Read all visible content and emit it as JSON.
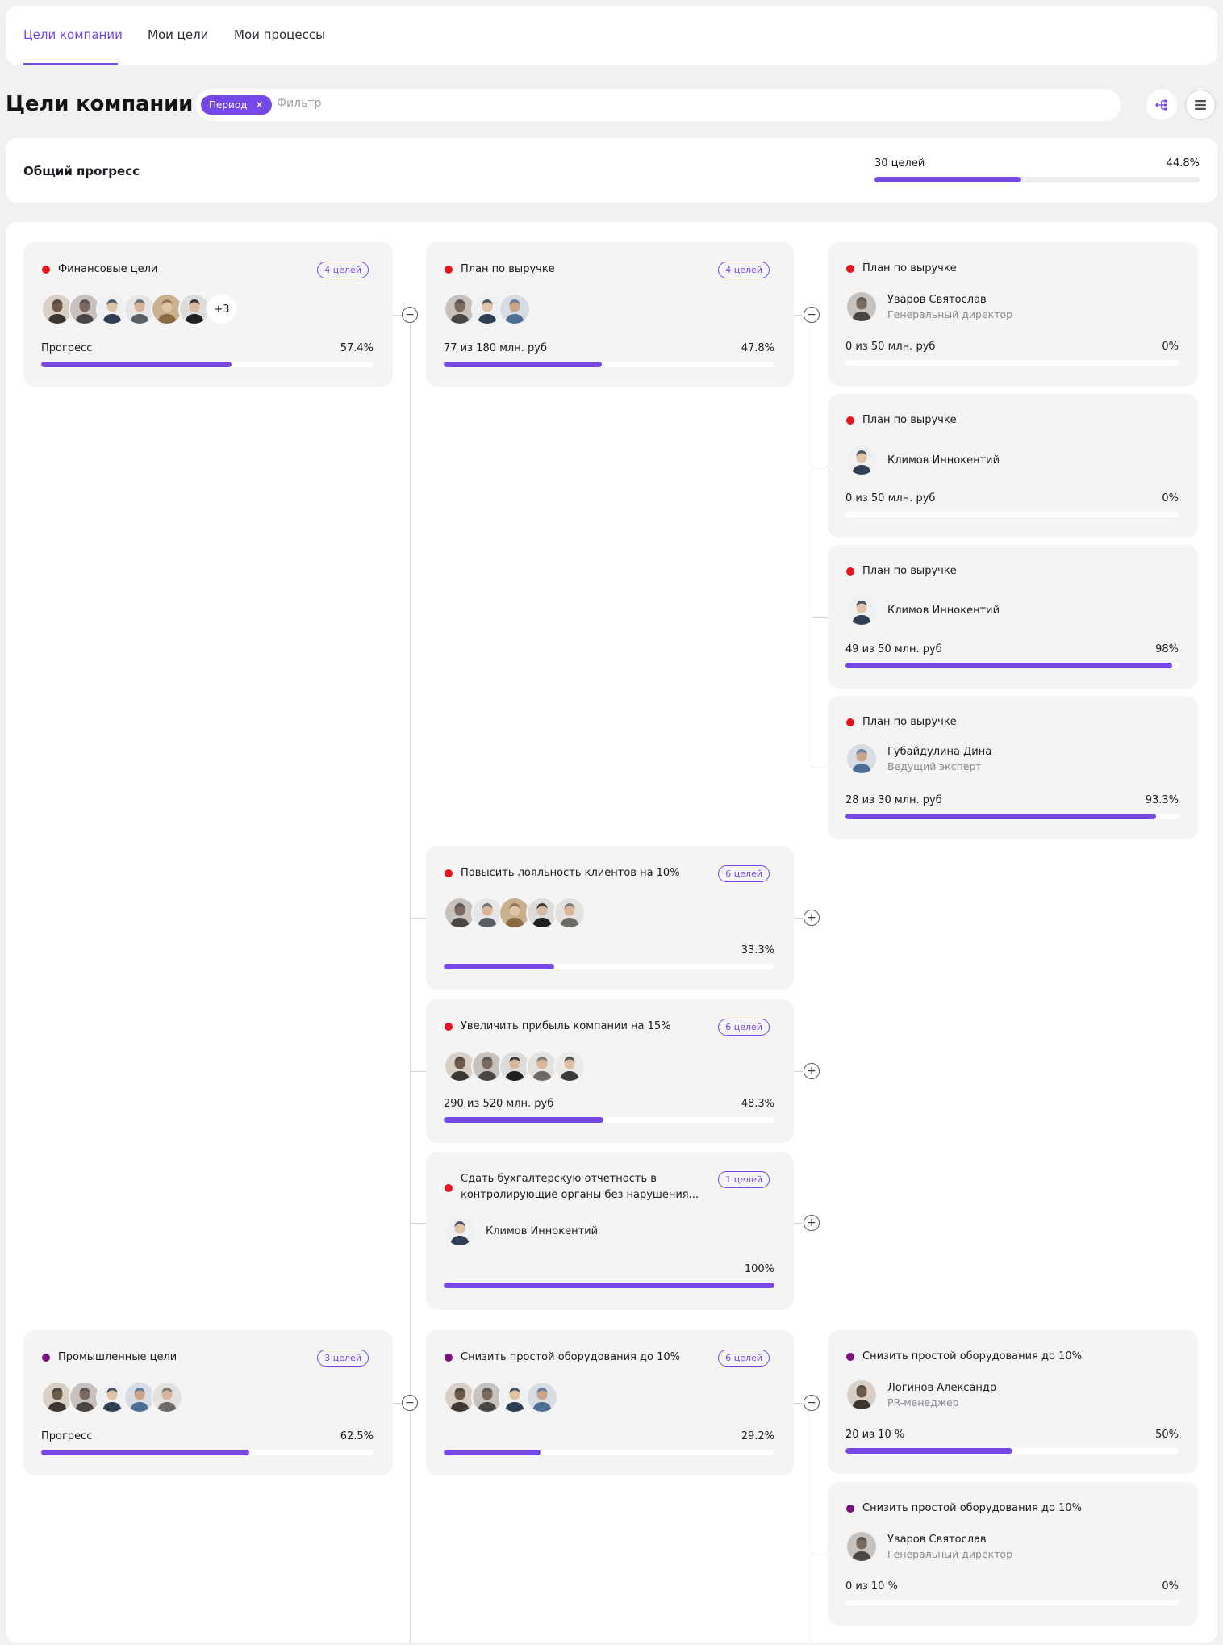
{
  "tabs": [
    {
      "label": "Цели компании"
    },
    {
      "label": "Мои цели"
    },
    {
      "label": "Мои процессы"
    }
  ],
  "header": {
    "title": "Цели компании",
    "period_chip": "Период",
    "filter_placeholder": "Фильтр"
  },
  "overall": {
    "label": "Общий прогресс",
    "count": "30 целей",
    "percent": "44.8%",
    "progress": 0.448
  },
  "colors": {
    "accent": "#7648e6",
    "red": "#e8141b",
    "purple": "#7a0f7e"
  },
  "cards": {
    "fin": {
      "title": "Финансовые цели",
      "badge": "4 целей",
      "more": "+3",
      "label": "Прогресс",
      "percent": "57.4%",
      "progress": 0.574
    },
    "rev": {
      "title": "План по выручке",
      "badge": "4 целей",
      "label": "77 из 180 млн. руб",
      "percent": "47.8%",
      "progress": 0.478
    },
    "rev1": {
      "title": "План по выручке",
      "name": "Уваров Святослав",
      "role": "Генеральный директор",
      "label": "0 из 50 млн. руб",
      "percent": "0%",
      "progress": 0
    },
    "rev2": {
      "title": "План по выручке",
      "name": "Климов Иннокентий",
      "label": "0 из 50 млн. руб",
      "percent": "0%",
      "progress": 0
    },
    "rev3": {
      "title": "План по выручке",
      "name": "Климов Иннокентий",
      "label": "49 из 50 млн. руб",
      "percent": "98%",
      "progress": 0.98
    },
    "rev4": {
      "title": "План по выручке",
      "name": "Губайдулина Дина",
      "role": "Ведущий эксперт",
      "label": "28 из 30 млн. руб",
      "percent": "93.3%",
      "progress": 0.933
    },
    "loyal": {
      "title": "Повысить лояльность клиентов на 10%",
      "badge": "6 целей",
      "percent": "33.3%",
      "progress": 0.333
    },
    "profit": {
      "title": "Увеличить прибыль компании на 15%",
      "badge": "6 целей",
      "label": "290 из 520 млн. руб",
      "percent": "48.3%",
      "progress": 0.483
    },
    "report": {
      "title": "Сдать бухгалтерскую отчетность в контролирующие органы без нарушения...",
      "badge": "1 целей",
      "name": "Климов Иннокентий",
      "percent": "100%",
      "progress": 1
    },
    "ind": {
      "title": "Промышленные цели",
      "badge": "3 целей",
      "label": "Прогресс",
      "percent": "62.5%",
      "progress": 0.625
    },
    "down": {
      "title": "Снизить простой оборудования до 10%",
      "badge": "6 целей",
      "percent": "29.2%",
      "progress": 0.292
    },
    "down1": {
      "title": "Снизить простой оборудования до 10%",
      "name": "Логинов Александр",
      "role": "PR-менеджер",
      "label": "20 из 10 %",
      "percent": "50%",
      "progress": 0.5
    },
    "down2": {
      "title": "Снизить простой оборудования до 10%",
      "name": "Уваров Святослав",
      "role": "Генеральный директор",
      "label": "0 из 10 %",
      "percent": "0%",
      "progress": 0
    }
  }
}
